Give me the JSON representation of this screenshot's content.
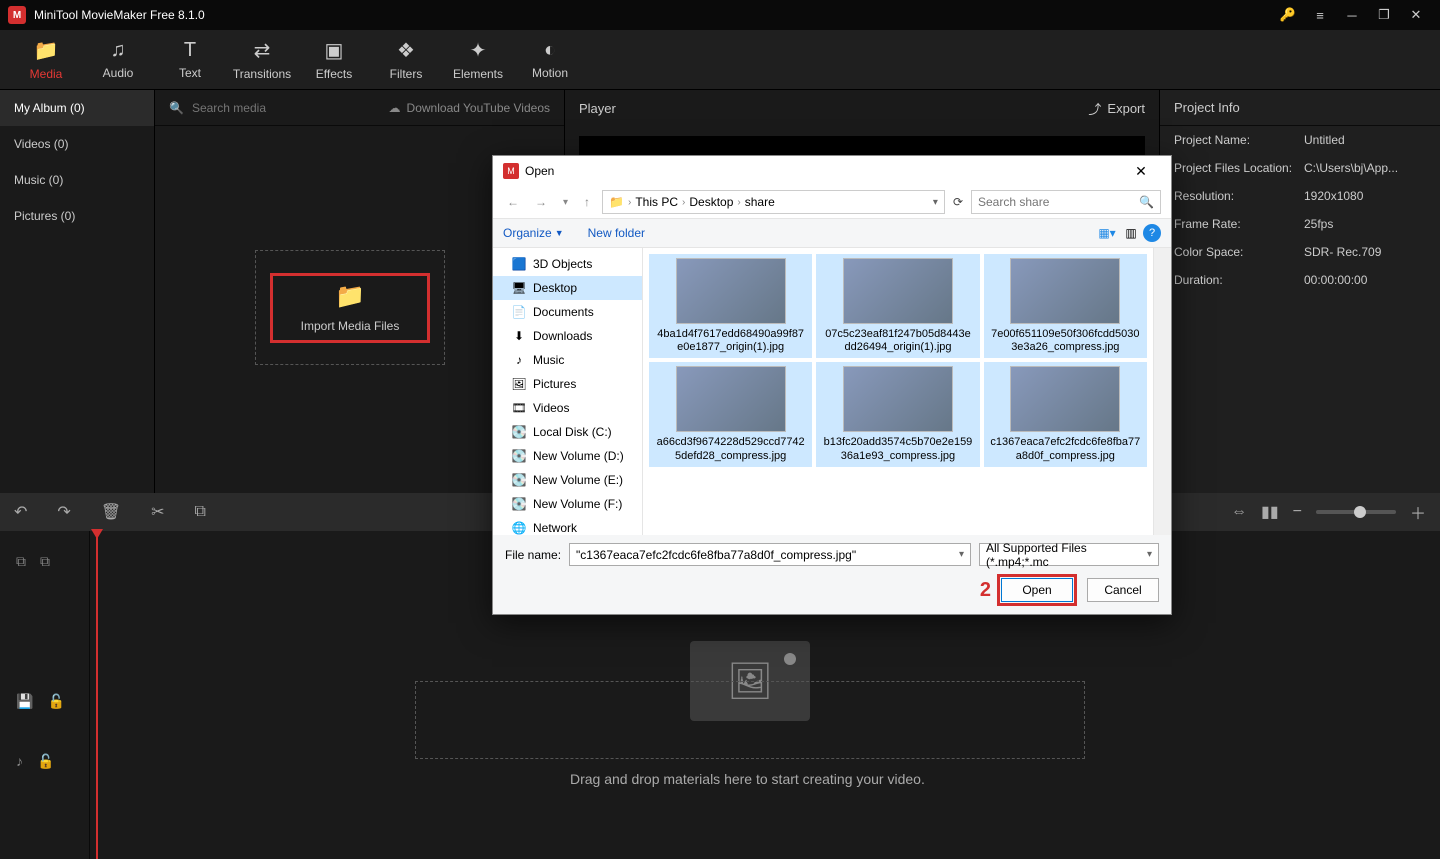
{
  "app": {
    "title": "MiniTool MovieMaker Free 8.1.0"
  },
  "topTabs": [
    {
      "label": "Media",
      "icon": "📁"
    },
    {
      "label": "Audio",
      "icon": "♫"
    },
    {
      "label": "Text",
      "icon": "T"
    },
    {
      "label": "Transitions",
      "icon": "⇄"
    },
    {
      "label": "Effects",
      "icon": "▣"
    },
    {
      "label": "Filters",
      "icon": "❖"
    },
    {
      "label": "Elements",
      "icon": "✦"
    },
    {
      "label": "Motion",
      "icon": "◐"
    }
  ],
  "sidebar": {
    "items": [
      {
        "label": "My Album (0)"
      },
      {
        "label": "Videos (0)"
      },
      {
        "label": "Music (0)"
      },
      {
        "label": "Pictures (0)"
      }
    ]
  },
  "mediaPanel": {
    "searchPlaceholder": "Search media",
    "downloadLabel": "Download YouTube Videos",
    "importLabel": "Import Media Files"
  },
  "player": {
    "title": "Player",
    "exportLabel": "Export"
  },
  "info": {
    "title": "Project Info",
    "rows": [
      {
        "k": "Project Name:",
        "v": "Untitled"
      },
      {
        "k": "Project Files Location:",
        "v": "C:\\Users\\bj\\App..."
      },
      {
        "k": "Resolution:",
        "v": "1920x1080"
      },
      {
        "k": "Frame Rate:",
        "v": "25fps"
      },
      {
        "k": "Color Space:",
        "v": "SDR- Rec.709"
      },
      {
        "k": "Duration:",
        "v": "00:00:00:00"
      }
    ]
  },
  "timeline": {
    "dropText": "Drag and drop materials here to start creating your video."
  },
  "dialog": {
    "title": "Open",
    "breadcrumb": [
      "This PC",
      "Desktop",
      "share"
    ],
    "searchPlaceholder": "Search share",
    "organize": "Organize",
    "newFolder": "New folder",
    "tree": [
      {
        "label": "3D Objects",
        "icon": "🟦"
      },
      {
        "label": "Desktop",
        "icon": "🖥",
        "selected": true
      },
      {
        "label": "Documents",
        "icon": "📄"
      },
      {
        "label": "Downloads",
        "icon": "⬇"
      },
      {
        "label": "Music",
        "icon": "♪"
      },
      {
        "label": "Pictures",
        "icon": "🖼"
      },
      {
        "label": "Videos",
        "icon": "🎞"
      },
      {
        "label": "Local Disk (C:)",
        "icon": "💽"
      },
      {
        "label": "New Volume (D:)",
        "icon": "💽"
      },
      {
        "label": "New Volume (E:)",
        "icon": "💽"
      },
      {
        "label": "New Volume (F:)",
        "icon": "💽"
      },
      {
        "label": "Network",
        "icon": "🌐"
      }
    ],
    "files": [
      {
        "name": "4ba1d4f7617edd68490a99f87e0e1877_origin(1).jpg",
        "thumb": "th-plants",
        "selected": true
      },
      {
        "name": "07c5c23eaf81f247b05d8443edd26494_origin(1).jpg",
        "thumb": "th-food",
        "selected": true
      },
      {
        "name": "7e00f651109e50f306fcdd50303e3a26_compress.jpg",
        "thumb": "th-flowers",
        "selected": true
      },
      {
        "name": "a66cd3f9674228d529ccd77425defd28_compress.jpg",
        "thumb": "th-sky",
        "selected": true
      },
      {
        "name": "b13fc20add3574c5b70e2e15936a1e93_compress.jpg",
        "thumb": "th-trees",
        "selected": true
      },
      {
        "name": "c1367eaca7efc2fcdc6fe8fba77a8d0f_compress.jpg",
        "thumb": "th-greensky",
        "selected": true
      }
    ],
    "fileNameLabel": "File name:",
    "fileNameValue": "\"c1367eaca7efc2fcdc6fe8fba77a8d0f_compress.jpg\"",
    "filterLabel": "All Supported Files (*.mp4;*.mc",
    "openLabel": "Open",
    "cancelLabel": "Cancel",
    "annotation": "2"
  }
}
